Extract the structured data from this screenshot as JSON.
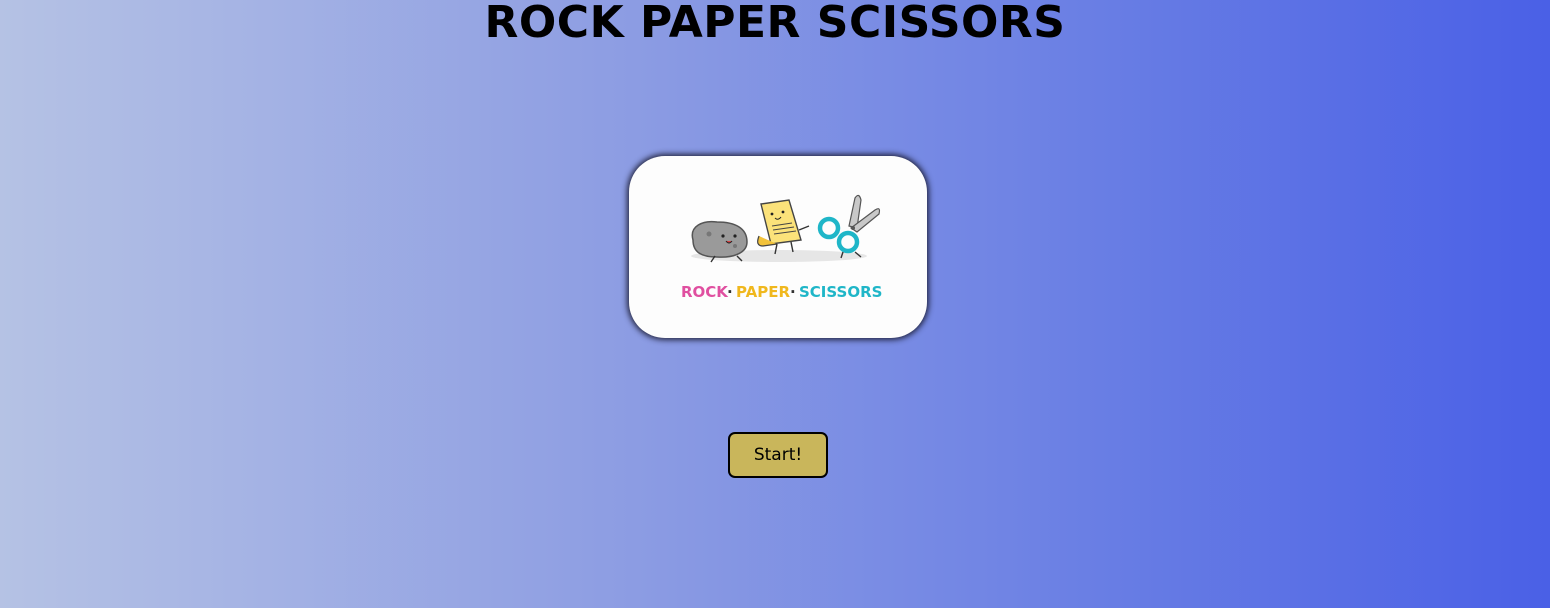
{
  "header": {
    "title": "ROCK PAPER SCISSORS"
  },
  "logo": {
    "words": [
      "ROCK",
      "PAPER",
      "SCISSORS"
    ],
    "separator": "·",
    "colors": {
      "rock": "#e04fa0",
      "paper": "#f0b81e",
      "scissors": "#1fb6c8"
    }
  },
  "controls": {
    "start_label": "Start!"
  },
  "colors": {
    "background_start": "#b5c2e4",
    "background_end": "#4a60e6",
    "button": "#c9b65b"
  }
}
